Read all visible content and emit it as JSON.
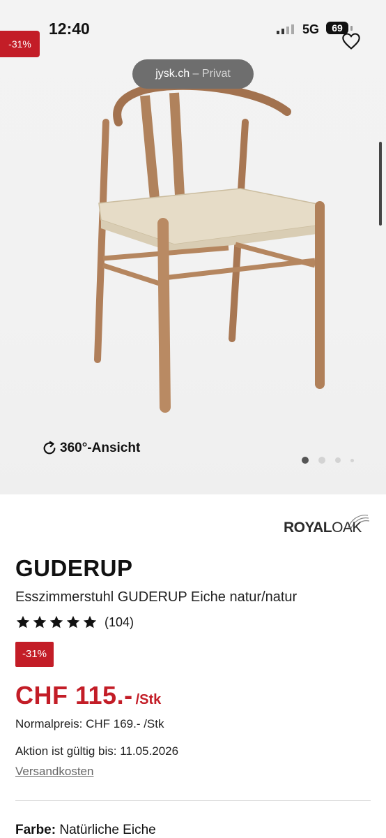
{
  "status_bar": {
    "time": "12:40",
    "network": "5G",
    "battery": "69"
  },
  "browser": {
    "domain": "jysk.ch",
    "mode": "– Privat"
  },
  "hero": {
    "discount_badge": "-31%",
    "view_360_label": "360°-Ansicht",
    "carousel_total": 4,
    "carousel_active": 1
  },
  "brand": {
    "royal": "ROYAL",
    "oak": "OAK"
  },
  "product": {
    "name": "GUDERUP",
    "subtitle": "Esszimmerstuhl GUDERUP Eiche natur/natur",
    "rating_stars": 5,
    "rating_count": "(104)",
    "discount": "-31%",
    "price": "CHF 115.-",
    "price_unit": "/Stk",
    "normal_price": "Normalpreis: CHF 169.- /Stk",
    "promo_valid": "Aktion ist gültig bis: 11.05.2026",
    "shipping_link": "Versandkosten",
    "color_label": "Farbe:",
    "color_value": "Natürliche Eiche"
  },
  "colors": {
    "accent_red": "#c31d27",
    "text": "#111111",
    "muted": "#666666"
  }
}
